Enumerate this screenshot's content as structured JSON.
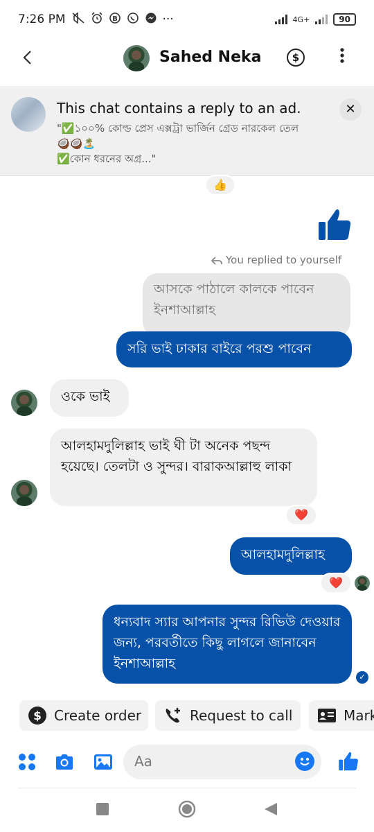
{
  "status_bar": {
    "time": "7:26 PM",
    "dots": "···",
    "network": "4G+",
    "battery": "90"
  },
  "header": {
    "contact_name": "Sahed Neka",
    "dollar": "$"
  },
  "ad_banner": {
    "title": "This chat contains a reply to an ad.",
    "snippet_line1": "\"✅১০০% কোল্ড প্রেস এক্সট্রা ভার্জিন গ্রেড নারকেল তেল",
    "snippet_line2": "🥥🥥🏝️",
    "snippet_line3": "✅কোন ধরনের অগ্র...\"",
    "close": "✕"
  },
  "messages": {
    "reaction_top": "👍",
    "replied_note": "You replied to yourself",
    "quoted_text": "আসকে পাঠালে কালকে পাবেন ইনশাআল্লাহ",
    "reply_text": "সরি ভাই ঢাকার বাইরে পরশু পাবেন",
    "them_1": "ওকে ভাই",
    "them_2": "আলহামদুলিল্লাহ ভাই ঘী টা অনেক পছন্দ হয়েছে। তেলটা ও সুন্দর। বারাকআল্লাহু লাকা",
    "reaction_heart_1": "❤️",
    "me_1": "আলহামদুলিল্লাহ",
    "reaction_heart_2": "❤️",
    "me_2": "ধন্যবাদ স্যার আপনার সুন্দর রিভিউ দেওয়ার জন্য, পরবর্তীতে কিছু লাগলে জানাবেন ইনশাআল্লাহ",
    "delivered": "✓"
  },
  "quick_actions": {
    "create_order": "Create order",
    "request_call": "Request to call",
    "mark": "Mark"
  },
  "composer": {
    "placeholder": "Aa"
  },
  "colors": {
    "accent": "#0751a8",
    "messenger_blue": "#1877f2",
    "bubble_gray": "#f0f0f0"
  },
  "icons": [
    "back-arrow",
    "dollar-circle",
    "more-vertical",
    "close",
    "like-thumb",
    "reply-arrow",
    "dollar-chip",
    "phone-plus",
    "id-card",
    "apps-grid",
    "camera",
    "gallery",
    "emoji",
    "square",
    "circle-home",
    "triangle-back"
  ]
}
